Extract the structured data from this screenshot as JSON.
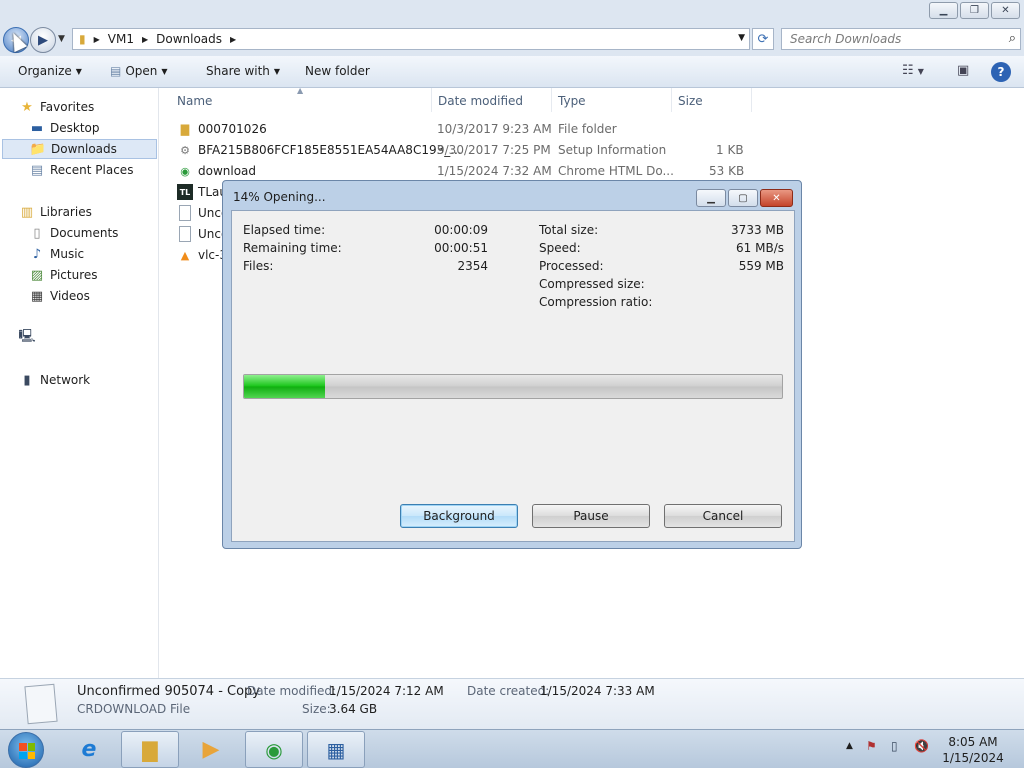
{
  "explorer": {
    "breadcrumb": [
      "VM1",
      "Downloads"
    ],
    "search_placeholder": "Search Downloads",
    "commands": {
      "organize": "Organize",
      "open": "Open",
      "share": "Share with",
      "new_folder": "New folder"
    },
    "nav": {
      "favorites": "Favorites",
      "desktop": "Desktop",
      "downloads": "Downloads",
      "recent": "Recent Places",
      "libraries": "Libraries",
      "documents": "Documents",
      "music": "Music",
      "pictures": "Pictures",
      "videos": "Videos",
      "network": "Network"
    },
    "columns": {
      "name": "Name",
      "date": "Date modified",
      "type": "Type",
      "size": "Size"
    },
    "files": [
      {
        "name": "000701026",
        "date": "10/3/2017 9:23 AM",
        "type": "File folder",
        "size": ""
      },
      {
        "name": "BFA215B806FCF185E8551EA54AA8C193_...",
        "date": "9/30/2017 7:25 PM",
        "type": "Setup Information",
        "size": "1 KB"
      },
      {
        "name": "download",
        "date": "1/15/2024 7:32 AM",
        "type": "Chrome HTML Do...",
        "size": "53 KB"
      },
      {
        "name": "TLau",
        "date": "",
        "type": "",
        "size": ""
      },
      {
        "name": "Unco",
        "date": "",
        "type": "",
        "size": ""
      },
      {
        "name": "Unco",
        "date": "",
        "type": "",
        "size": ""
      },
      {
        "name": "vlc-3",
        "date": "",
        "type": "",
        "size": ""
      }
    ],
    "details": {
      "name": "Unconfirmed 905074 - Copy",
      "type": "CRDOWNLOAD File",
      "modified_label": "Date modified:",
      "modified": "1/15/2024 7:12 AM",
      "created_label": "Date created:",
      "created": "1/15/2024 7:33 AM",
      "size_label": "Size:",
      "size": "3.64 GB"
    }
  },
  "dialog": {
    "title": "14% Opening...",
    "elapsed_label": "Elapsed time:",
    "elapsed": "00:00:09",
    "remaining_label": "Remaining time:",
    "remaining": "00:00:51",
    "files_label": "Files:",
    "files": "2354",
    "total_label": "Total size:",
    "total": "3733 MB",
    "speed_label": "Speed:",
    "speed": "61 MB/s",
    "processed_label": "Processed:",
    "processed": "559 MB",
    "compressed_label": "Compressed size:",
    "ratio_label": "Compression ratio:",
    "progress_fraction": 0.15,
    "buttons": {
      "background": "Background",
      "pause": "Pause",
      "cancel": "Cancel"
    }
  },
  "taskbar": {
    "time": "8:05 AM",
    "date": "1/15/2024"
  },
  "colors": {
    "accent": "#3c7fb1",
    "progress": "#17c417"
  }
}
